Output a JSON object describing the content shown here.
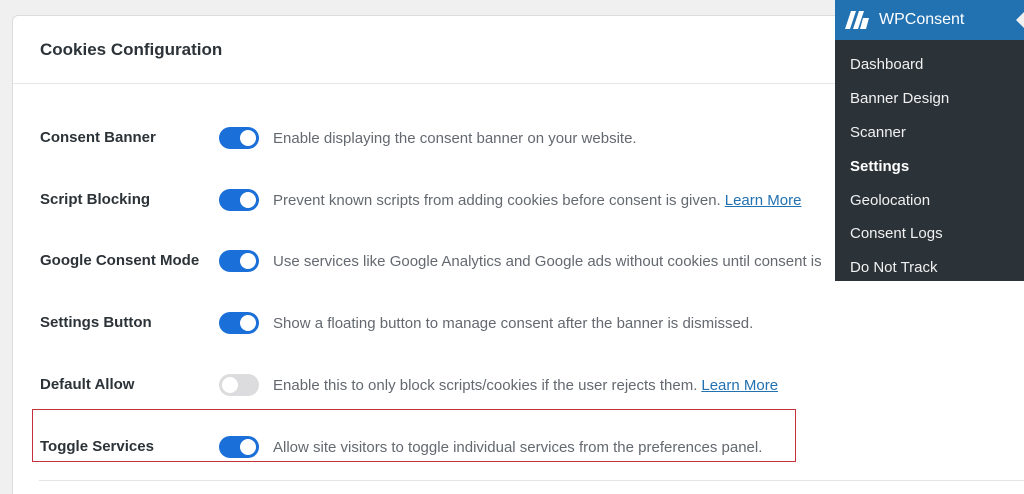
{
  "card": {
    "title": "Cookies Configuration",
    "rows": [
      {
        "label": "Consent Banner",
        "toggle": "on",
        "description": "Enable displaying the consent banner on your website.",
        "link": ""
      },
      {
        "label": "Script Blocking",
        "toggle": "on",
        "description": "Prevent known scripts from adding cookies before consent is given.",
        "link": "Learn More"
      },
      {
        "label": "Google Consent Mode",
        "toggle": "on",
        "description": "Use services like Google Analytics and Google ads without cookies until consent is",
        "link": ""
      },
      {
        "label": "Settings Button",
        "toggle": "on",
        "description": "Show a floating button to manage consent after the banner is dismissed.",
        "link": ""
      },
      {
        "label": "Default Allow",
        "toggle": "off",
        "description": "Enable this to only block scripts/cookies if the user rejects them.",
        "link": "Learn More"
      },
      {
        "label": "Toggle Services",
        "toggle": "on",
        "description": "Allow site visitors to toggle individual services from the preferences panel.",
        "link": ""
      }
    ]
  },
  "wp_menu": {
    "title": "WPConsent",
    "logo_icon": "wpconsent-logo-icon",
    "items": [
      {
        "label": "Dashboard",
        "active": false
      },
      {
        "label": "Banner Design",
        "active": false
      },
      {
        "label": "Scanner",
        "active": false
      },
      {
        "label": "Settings",
        "active": true
      },
      {
        "label": "Geolocation",
        "active": false
      },
      {
        "label": "Consent Logs",
        "active": false
      },
      {
        "label": "Do Not Track",
        "active": false
      }
    ]
  },
  "colors": {
    "accent": "#1a6fd8",
    "menu_bg": "#2c3338",
    "menu_header": "#2271b1",
    "highlight": "#c4303b",
    "link": "#2271b1"
  }
}
